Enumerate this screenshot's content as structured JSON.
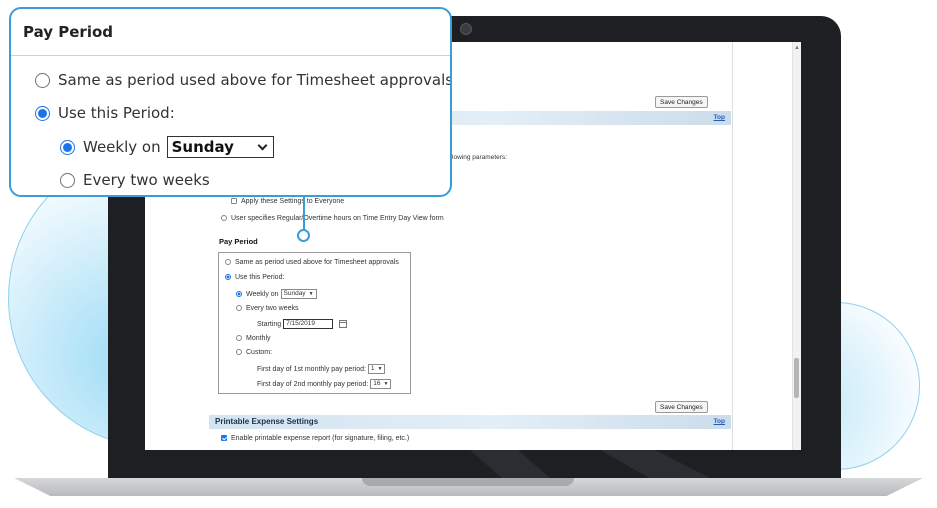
{
  "callout": {
    "title": "Pay Period",
    "option_same": "Same as period used above for Timesheet approvals",
    "option_use": "Use this Period:",
    "weekly_prefix": "Weekly on",
    "weekly_value": "Sunday",
    "every_two": "Every two weeks"
  },
  "screen": {
    "save_changes_top": "Save Changes",
    "top_link": "Top",
    "partial_text": "ollowing parameters:",
    "apply_everyone": "Apply these Settings to Everyone",
    "user_specifies": "User specifies Regular/Overtime hours on Time Entry Day View form",
    "pay_period_heading": "Pay Period",
    "same_period": "Same as period used above for Timesheet approvals",
    "use_period": "Use this Period:",
    "weekly_on": "Weekly on",
    "weekly_value": "Sunday",
    "every_two_weeks": "Every two weeks",
    "starting_label": "Starting",
    "starting_value": "7/15/2019",
    "monthly": "Monthly",
    "custom": "Custom:",
    "first_day_1st": "First day of 1st monthly pay period:",
    "first_day_1st_value": "1",
    "first_day_2nd": "First day of 2nd monthly pay period:",
    "first_day_2nd_value": "16",
    "save_changes_bottom": "Save Changes",
    "printable_title": "Printable Expense Settings",
    "top_link_2": "Top",
    "enable_printable": "Enable printable expense report (for signature, filing, etc.)"
  },
  "colors": {
    "accent": "#3a9dd6",
    "radio_selected": "#1a73e8",
    "laptop": "#1e1f23"
  }
}
